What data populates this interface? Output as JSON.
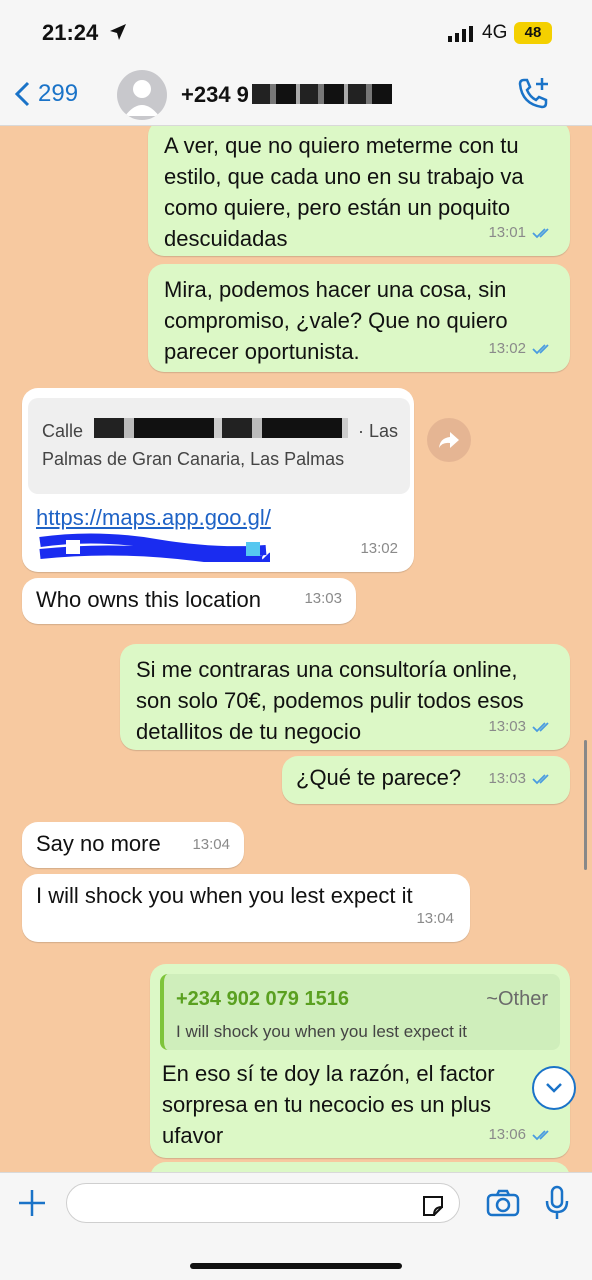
{
  "status_bar": {
    "time": "21:24",
    "network": "4G",
    "battery": "48"
  },
  "header": {
    "back_count": "299",
    "contact": "+234 9"
  },
  "messages": [
    {
      "text": "A ver, que no quiero meterme con tu\nestilo, que cada uno en su trabajo va\ncomo quiere, pero están un poquito\ndescuidadas",
      "time": "13:01"
    },
    {
      "text": "Mira, podemos hacer una cosa, sin\ncompromiso, ¿vale? Que no quiero\nparecer oportunista.",
      "time": "13:02"
    },
    {
      "loc_line1": "Calle",
      "loc_line1b": "· Las",
      "loc_line2": "Palmas de Gran Canaria, Las Palmas",
      "link": "https://maps.app.goo.gl/",
      "time": "13:02"
    },
    {
      "text": "Who owns this location",
      "time": "13:03"
    },
    {
      "text": "Si me contraras una consultoría online,\nson solo 70€, podemos pulir todos esos\ndetallitos de tu negocio",
      "time": "13:03"
    },
    {
      "text": "¿Qué te parece?",
      "time": "13:03"
    },
    {
      "text": "Say no more",
      "time": "13:04"
    },
    {
      "text": "I will shock you when you lest expect it",
      "time": "13:04"
    },
    {
      "quote_name": "+234 902 079 1516",
      "quote_other": "~Other",
      "quote_text": "I will shock you when you lest expect it",
      "text": "En eso sí te doy la razón, el factor\nsorpresa en tu necocio es un plus\nufavor",
      "time": "13:06"
    }
  ],
  "colors": {
    "accent": "#1a73c8",
    "outgoing": "#dcf8c6",
    "incoming": "#ffffff",
    "background": "#f7c9a0"
  }
}
